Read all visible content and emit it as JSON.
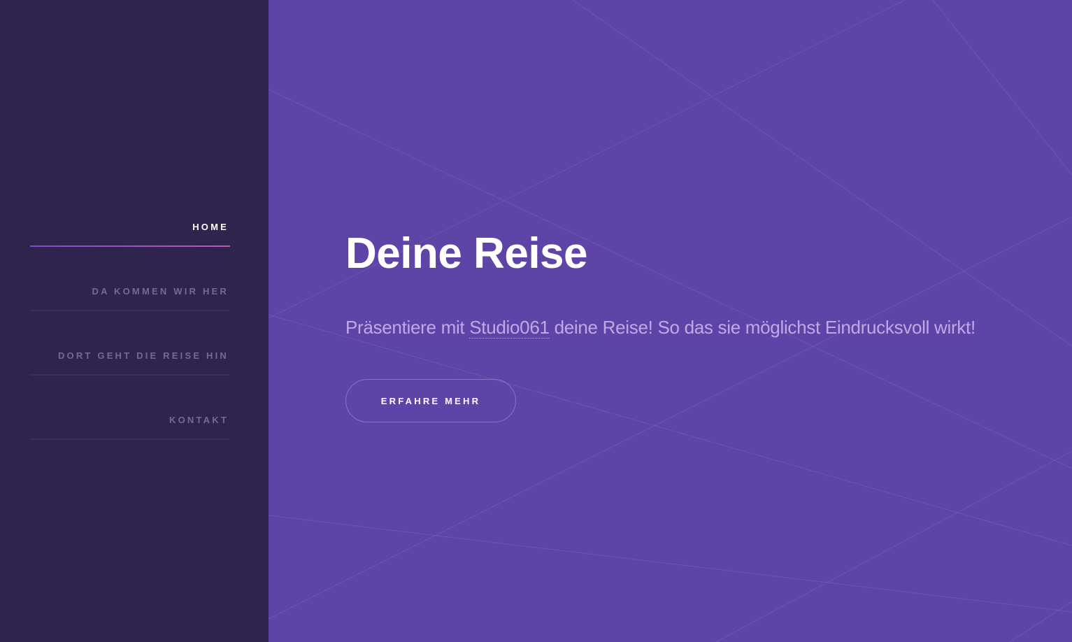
{
  "nav": {
    "items": [
      {
        "label": "HOME",
        "active": true
      },
      {
        "label": "DA KOMMEN WIR HER",
        "active": false
      },
      {
        "label": "DORT GEHT DIE REISE HIN",
        "active": false
      },
      {
        "label": "KONTAKT",
        "active": false
      }
    ]
  },
  "hero": {
    "title": "Deine Reise",
    "text_before": "Präsentiere mit ",
    "brand": "Studio061",
    "text_after": " deine Reise! So das sie möglichst Eindrucksvoll wirkt!",
    "cta_label": "ERFAHRE MEHR"
  },
  "colors": {
    "sidebar_bg": "#2f244d",
    "main_bg": "#5e44a6",
    "accent": "#b95ab0",
    "text_muted": "#c1a9e8"
  }
}
